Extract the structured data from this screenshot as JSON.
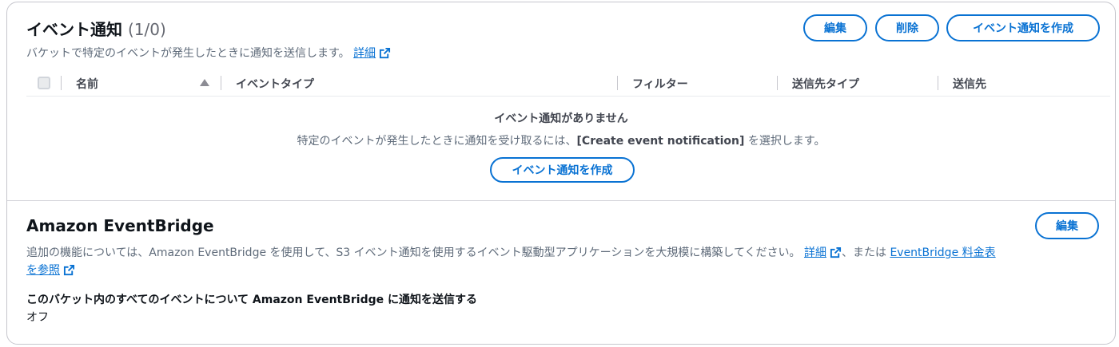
{
  "event_notifications": {
    "title": "イベント通知",
    "count": "(1/0)",
    "description": "バケットで特定のイベントが発生したときに通知を送信します。",
    "info_link": "詳細",
    "buttons": {
      "edit": "編集",
      "delete": "削除",
      "create": "イベント通知を作成"
    },
    "table": {
      "columns": [
        "名前",
        "イベントタイプ",
        "フィルター",
        "送信先タイプ",
        "送信先"
      ]
    },
    "empty_state": {
      "title": "イベント通知がありません",
      "desc_prefix": "特定のイベントが発生したときに通知を受け取るには、",
      "desc_bold": "[Create event notification]",
      "desc_suffix": " を選択します。",
      "button": "イベント通知を作成"
    }
  },
  "eventbridge": {
    "title": "Amazon EventBridge",
    "edit_button": "編集",
    "description": "追加の機能については、Amazon EventBridge を使用して、S3 イベント通知を使用するイベント駆動型アプリケーションを大規模に構築してください。",
    "info_link": "詳細",
    "or_text": "、または",
    "pricing_link_line1": "EventBridge 料金表",
    "pricing_link_line2": "を参照",
    "field_label": "このバケット内のすべてのイベントについて Amazon EventBridge に通知を送信する",
    "field_value": "オフ"
  },
  "colors": {
    "link": "#0972d3",
    "text": "#0f141a",
    "muted": "#5f6b7a",
    "border": "#c6c6cd"
  },
  "icons": {
    "external": "external-link-icon",
    "sort": "sort-ascending-icon",
    "checkbox": "select-all-checkbox"
  }
}
